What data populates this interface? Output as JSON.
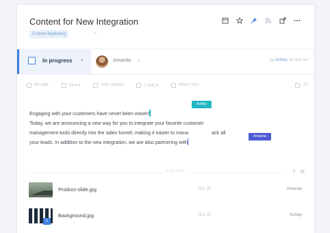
{
  "task": {
    "title": "Content for New Integration",
    "tag": "Content Marketing",
    "tag_close": "×"
  },
  "status": {
    "label": "In progress",
    "caret": "▾",
    "assignee": "Amanda",
    "assignee_caret": "▾",
    "created_by_prefix": "by",
    "created_by": "Ashley",
    "created_on": "on Nov 14"
  },
  "toolbar": [
    {
      "icon": "calendar-icon",
      "label": "No date"
    },
    {
      "icon": "priority-icon",
      "label": "Med ▾"
    },
    {
      "icon": "subtasks-icon",
      "label": "Add subtask"
    },
    {
      "icon": "checklist-icon",
      "label": "1 field ▾"
    },
    {
      "icon": "attach-icon",
      "label": "Attach files"
    },
    {
      "icon": "comments-icon",
      "label": "10"
    }
  ],
  "editor": {
    "line1": "Engaging with your customers have never been easier!",
    "line2": "Today, we are announcing a new way for you to integrate your favorite customer",
    "line3a": "management tools directly into the sales funnel, making it easier to mana",
    "line3b": "ack all",
    "line4": "your leads. In addition to the new integration, we are also partnering with",
    "cursor_teal_user": "Ashley",
    "cursor_blue_user": "Amanda"
  },
  "attachments": {
    "count_label": "2 FILES",
    "files": [
      {
        "name": "Product-slide.jpg",
        "date": "Nov 26",
        "user": "Amanda"
      },
      {
        "name": "Background.jpg",
        "date": "Nov 26",
        "user": "Ashley",
        "badge": "2"
      }
    ]
  },
  "colors": {
    "accent": "#3f7fe0",
    "cursor_teal": "#23b7c4",
    "cursor_blue": "#4c5bd4"
  },
  "icons": {
    "top_actions": [
      "calendar-icon",
      "star-icon",
      "pin-icon",
      "rss-icon",
      "share-icon",
      "more-icon"
    ]
  }
}
